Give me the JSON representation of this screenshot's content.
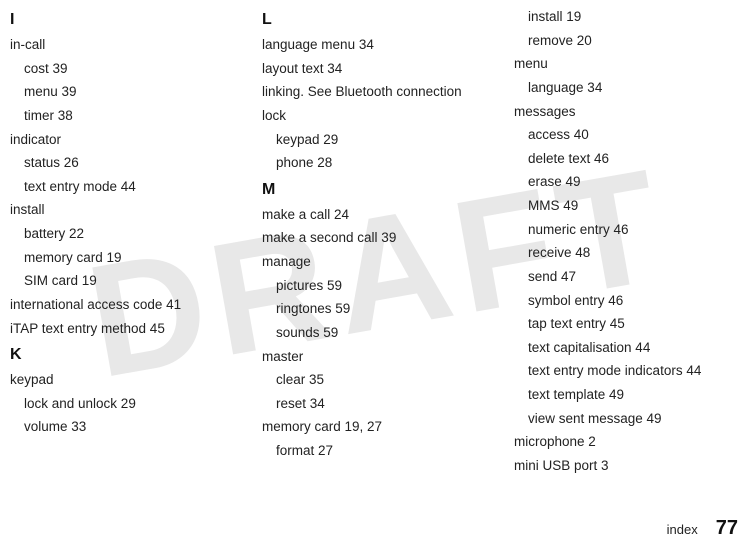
{
  "watermark": "DRAFT",
  "columns": [
    {
      "sections": [
        {
          "letter": "I",
          "entries": [
            {
              "text": "in-call",
              "sub": false
            },
            {
              "text": "cost  39",
              "sub": true
            },
            {
              "text": "menu  39",
              "sub": true
            },
            {
              "text": "timer  38",
              "sub": true
            },
            {
              "text": "indicator",
              "sub": false
            },
            {
              "text": "status  26",
              "sub": true
            },
            {
              "text": "text entry mode  44",
              "sub": true
            },
            {
              "text": "install",
              "sub": false
            },
            {
              "text": "battery  22",
              "sub": true
            },
            {
              "text": "memory card  19",
              "sub": true
            },
            {
              "text": "SIM card  19",
              "sub": true
            },
            {
              "text": "international access code  41",
              "sub": false
            },
            {
              "text": "iTAP text entry method  45",
              "sub": false
            }
          ]
        },
        {
          "letter": "K",
          "entries": [
            {
              "text": "keypad",
              "sub": false
            },
            {
              "text": "lock and unlock  29",
              "sub": true
            },
            {
              "text": "volume  33",
              "sub": true
            }
          ]
        }
      ]
    },
    {
      "sections": [
        {
          "letter": "L",
          "entries": [
            {
              "text": "language menu  34",
              "sub": false
            },
            {
              "text": "layout text  34",
              "sub": false
            },
            {
              "text": "linking. See Bluetooth connection",
              "sub": false
            },
            {
              "text": "lock",
              "sub": false
            },
            {
              "text": "keypad  29",
              "sub": true
            },
            {
              "text": "phone  28",
              "sub": true
            }
          ]
        },
        {
          "letter": "M",
          "entries": [
            {
              "text": "make a call  24",
              "sub": false
            },
            {
              "text": "make a second call  39",
              "sub": false
            },
            {
              "text": "manage",
              "sub": false
            },
            {
              "text": "pictures  59",
              "sub": true
            },
            {
              "text": "ringtones  59",
              "sub": true
            },
            {
              "text": "sounds  59",
              "sub": true
            },
            {
              "text": "master",
              "sub": false
            },
            {
              "text": "clear  35",
              "sub": true
            },
            {
              "text": "reset  34",
              "sub": true
            },
            {
              "text": "memory card  19, 27",
              "sub": false
            },
            {
              "text": "format  27",
              "sub": true
            }
          ]
        }
      ]
    },
    {
      "sections": [
        {
          "letter": "",
          "entries": [
            {
              "text": "install  19",
              "sub": true
            },
            {
              "text": "remove  20",
              "sub": true
            },
            {
              "text": "menu",
              "sub": false
            },
            {
              "text": "language  34",
              "sub": true
            },
            {
              "text": "messages",
              "sub": false
            },
            {
              "text": "access  40",
              "sub": true
            },
            {
              "text": "delete text  46",
              "sub": true
            },
            {
              "text": "erase  49",
              "sub": true
            },
            {
              "text": "MMS  49",
              "sub": true
            },
            {
              "text": "numeric entry  46",
              "sub": true
            },
            {
              "text": "receive  48",
              "sub": true
            },
            {
              "text": "send  47",
              "sub": true
            },
            {
              "text": "symbol entry  46",
              "sub": true
            },
            {
              "text": "tap text entry  45",
              "sub": true
            },
            {
              "text": "text capitalisation  44",
              "sub": true
            },
            {
              "text": "text entry mode indicators  44",
              "sub": true
            },
            {
              "text": "text template  49",
              "sub": true
            },
            {
              "text": "view sent message  49",
              "sub": true
            },
            {
              "text": "microphone  2",
              "sub": false
            },
            {
              "text": "mini USB port  3",
              "sub": false
            }
          ]
        }
      ]
    }
  ],
  "footer": {
    "label": "index",
    "page": "77"
  }
}
